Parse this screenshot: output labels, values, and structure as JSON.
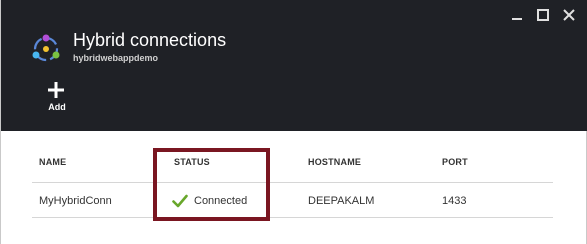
{
  "header": {
    "title": "Hybrid connections",
    "subtitle": "hybridwebappdemo",
    "app_icon": "hybrid-connections-icon",
    "window_controls": [
      "minimize-icon",
      "maximize-icon",
      "close-icon"
    ]
  },
  "toolbar": {
    "add_label": "Add",
    "add_icon": "plus-icon"
  },
  "table": {
    "columns": [
      "NAME",
      "STATUS",
      "HOSTNAME",
      "PORT"
    ],
    "rows": [
      {
        "name": "MyHybridConn",
        "status": "Connected",
        "hostname": "DEEPAKALM",
        "port": "1433"
      }
    ]
  },
  "colors": {
    "header_bg": "#1f2126",
    "highlight": "#7a1621",
    "status_ok": "#68a72b"
  }
}
